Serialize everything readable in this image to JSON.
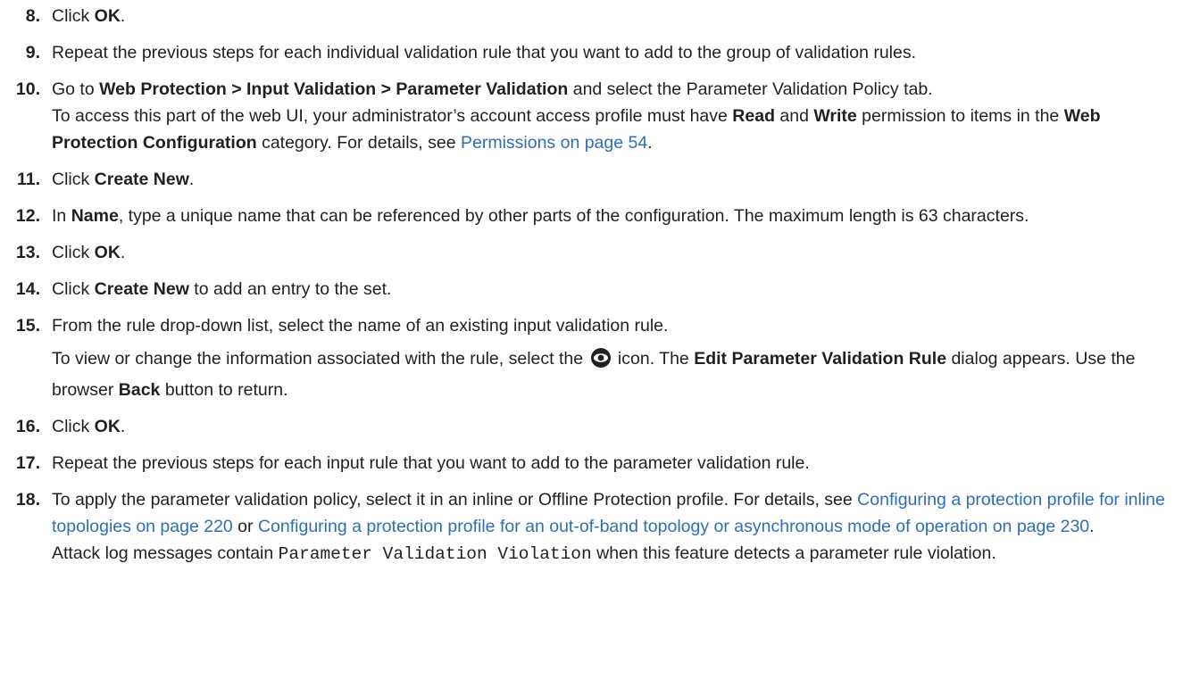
{
  "steps": [
    {
      "num": "8.",
      "t": [
        "Click ",
        "OK",
        "."
      ]
    },
    {
      "num": "9.",
      "t": [
        "Repeat the previous steps for each individual validation rule that you want to add to the group of validation rules."
      ]
    },
    {
      "num": "10.",
      "p1": [
        "Go to ",
        "Web Protection > Input Validation > Parameter Validation",
        " and select the Parameter Validation Policy tab."
      ],
      "p2": [
        "To access this part of the web UI, your administrator’s account access profile must have ",
        "Read",
        " and ",
        "Write",
        " permission to items in the ",
        "Web Protection Configuration",
        " category. For details, see ",
        "Permissions on page 54",
        "."
      ]
    },
    {
      "num": "11.",
      "t": [
        "Click ",
        "Create New",
        "."
      ]
    },
    {
      "num": "12.",
      "t": [
        "In ",
        "Name",
        ", type a unique name that can be referenced by other parts of the configuration. The maximum length is 63 characters."
      ]
    },
    {
      "num": "13.",
      "t": [
        "Click ",
        "OK",
        "."
      ]
    },
    {
      "num": "14.",
      "t": [
        "Click ",
        "Create New",
        " to add an entry to the set."
      ]
    },
    {
      "num": "15.",
      "p1": "From the rule drop-down list, select the name of an existing input validation rule.",
      "p2": [
        "To view or change the information associated with the rule, select the ",
        "icon. The ",
        "Edit Parameter Validation Rule",
        " dialog appears. Use the browser ",
        "Back",
        " button to return."
      ]
    },
    {
      "num": "16.",
      "t": [
        "Click ",
        "OK",
        "."
      ]
    },
    {
      "num": "17.",
      "t": [
        "Repeat the previous steps for each input rule that you want to add to the parameter validation rule."
      ]
    },
    {
      "num": "18.",
      "p1": [
        "To apply the parameter validation policy, select it in an inline or Offline Protection profile. For details, see ",
        "Configuring a protection profile for inline topologies on page 220",
        " or ",
        "Configuring a protection profile for an out-of-band topology or asynchronous mode of operation on page 230",
        "."
      ],
      "p2": [
        "Attack log messages contain ",
        "Parameter Validation Violation",
        " when this feature detects a parameter rule violation."
      ]
    }
  ],
  "colors": {
    "text": "#231f20",
    "link": "#2e6eb4",
    "icon": "#231f20"
  },
  "icons": [
    "eye-icon"
  ]
}
